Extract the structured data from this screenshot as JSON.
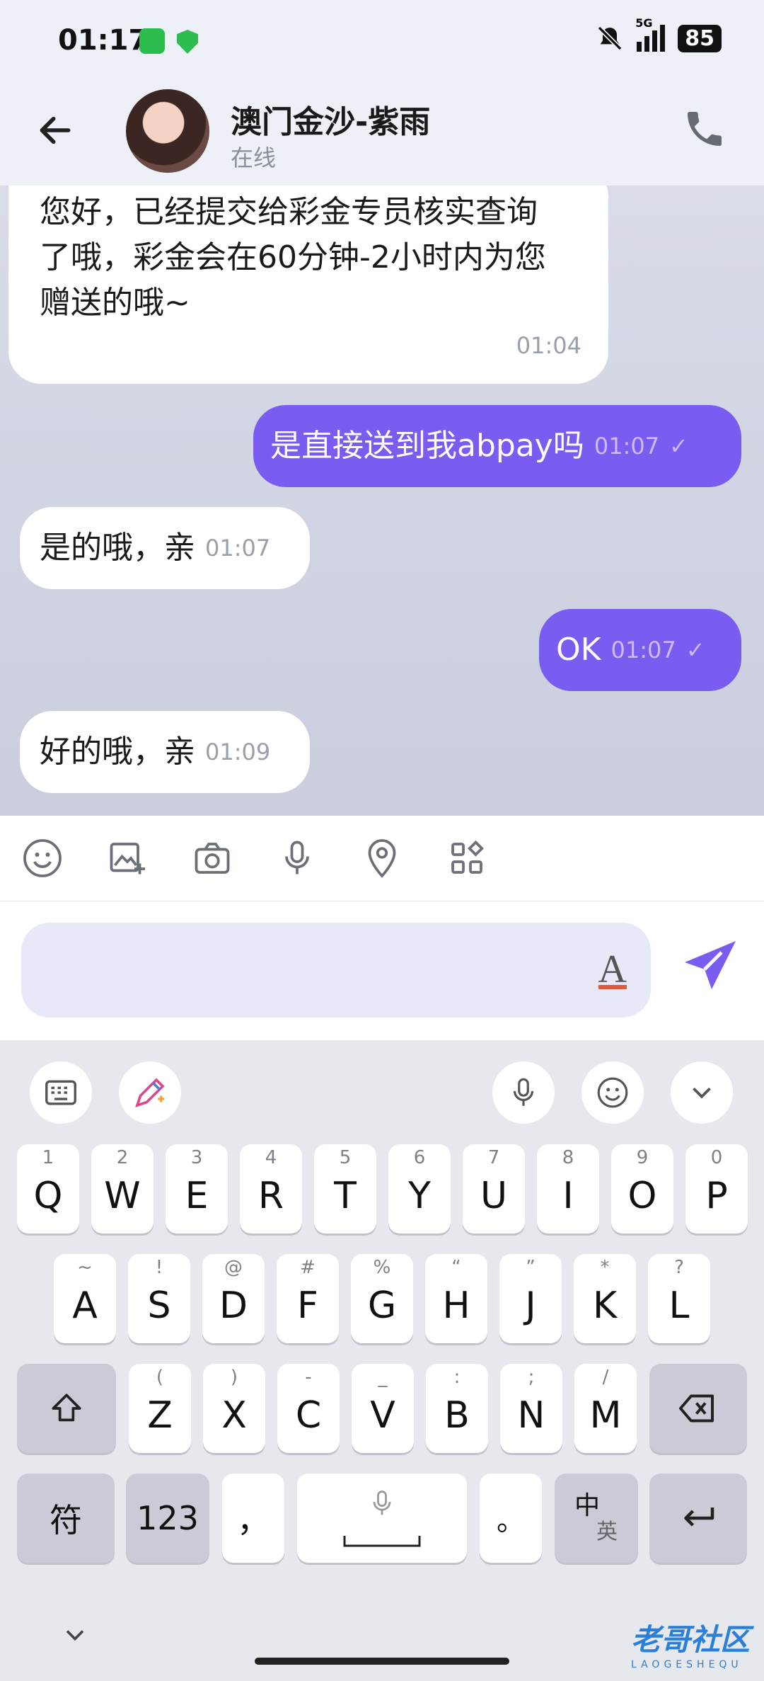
{
  "status": {
    "time": "01:17",
    "network": "5G",
    "battery": "85"
  },
  "header": {
    "contact_name": "澳门金沙-紫雨",
    "presence": "在线"
  },
  "messages": [
    {
      "dir": "in",
      "text": "您好，已经提交给彩金专员核实查询了哦，彩金会在60分钟-2小时内为您赠送的哦~",
      "line1": "您好，已经提交给彩金专员核实查询",
      "line2": "了哦，彩金会在60分钟-2小时内为您",
      "line3": "赠送的哦~",
      "time": "01:04"
    },
    {
      "dir": "out",
      "text": "是直接送到我abpay吗",
      "time": "01:07"
    },
    {
      "dir": "in",
      "text": "是的哦，亲",
      "time": "01:07"
    },
    {
      "dir": "out",
      "text": "OK",
      "time": "01:07"
    },
    {
      "dir": "in",
      "text": "好的哦，亲",
      "time": "01:09"
    }
  ],
  "input": {
    "value": "",
    "format_label": "A"
  },
  "keyboard": {
    "row1": [
      {
        "k": "Q",
        "h": "1"
      },
      {
        "k": "W",
        "h": "2"
      },
      {
        "k": "E",
        "h": "3"
      },
      {
        "k": "R",
        "h": "4"
      },
      {
        "k": "T",
        "h": "5"
      },
      {
        "k": "Y",
        "h": "6"
      },
      {
        "k": "U",
        "h": "7"
      },
      {
        "k": "I",
        "h": "8"
      },
      {
        "k": "O",
        "h": "9"
      },
      {
        "k": "P",
        "h": "0"
      }
    ],
    "row2": [
      {
        "k": "A",
        "h": "~"
      },
      {
        "k": "S",
        "h": "!"
      },
      {
        "k": "D",
        "h": "@"
      },
      {
        "k": "F",
        "h": "#"
      },
      {
        "k": "G",
        "h": "%"
      },
      {
        "k": "H",
        "h": "“"
      },
      {
        "k": "J",
        "h": "”"
      },
      {
        "k": "K",
        "h": "*"
      },
      {
        "k": "L",
        "h": "?"
      }
    ],
    "row3": [
      {
        "k": "Z",
        "h": "("
      },
      {
        "k": "X",
        "h": ")"
      },
      {
        "k": "C",
        "h": "-"
      },
      {
        "k": "V",
        "h": "_"
      },
      {
        "k": "B",
        "h": ":"
      },
      {
        "k": "N",
        "h": ";"
      },
      {
        "k": "M",
        "h": "/"
      }
    ],
    "sym_label": "符",
    "num_label": "123",
    "comma_label": "，",
    "period_label": "。",
    "lang_label_top": "中",
    "lang_label_bottom": "英"
  },
  "watermark": {
    "text": "老哥社区",
    "sub": "LAOGESHEQU"
  }
}
